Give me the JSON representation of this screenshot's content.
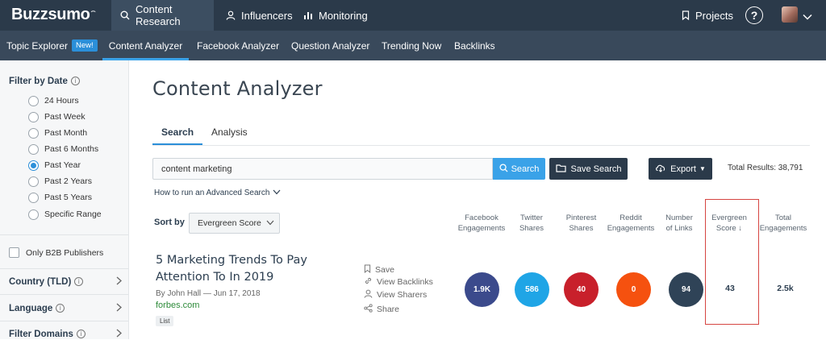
{
  "brand": {
    "logo": "Buzzsumo"
  },
  "topnav": {
    "items": [
      {
        "label": "Content Research",
        "icon": "search-icon",
        "active": true
      },
      {
        "label": "Influencers",
        "icon": "user-icon",
        "active": false
      },
      {
        "label": "Monitoring",
        "icon": "bar-chart-icon",
        "active": false
      }
    ],
    "projects_label": "Projects",
    "help_label": "?"
  },
  "subnav": {
    "items": [
      {
        "label": "Topic Explorer",
        "badge": "New!"
      },
      {
        "label": "Content Analyzer",
        "active": true
      },
      {
        "label": "Facebook Analyzer"
      },
      {
        "label": "Question Analyzer"
      },
      {
        "label": "Trending Now"
      },
      {
        "label": "Backlinks"
      }
    ]
  },
  "sidebar": {
    "filter_title": "Filter by Date",
    "date_options": [
      "24 Hours",
      "Past Week",
      "Past Month",
      "Past 6 Months",
      "Past Year",
      "Past 2 Years",
      "Past 5 Years",
      "Specific Range"
    ],
    "selected_date": "Past Year",
    "b2b_label": "Only B2B Publishers",
    "sections": [
      "Country (TLD)",
      "Language",
      "Filter Domains"
    ]
  },
  "main": {
    "title": "Content Analyzer",
    "tabs": [
      {
        "label": "Search",
        "active": true
      },
      {
        "label": "Analysis",
        "active": false
      }
    ],
    "search": {
      "value": "content marketing",
      "button": "Search"
    },
    "save_search": "Save Search",
    "export": "Export",
    "total_results": "Total Results: 38,791",
    "advanced_link": "How to run an Advanced Search",
    "sort": {
      "label": "Sort by",
      "value": "Evergreen Score"
    },
    "columns": [
      {
        "line1": "Facebook",
        "line2": "Engagements"
      },
      {
        "line1": "Twitter",
        "line2": "Shares"
      },
      {
        "line1": "Pinterest",
        "line2": "Shares"
      },
      {
        "line1": "Reddit",
        "line2": "Engagements"
      },
      {
        "line1": "Number",
        "line2": "of Links"
      },
      {
        "line1": "Evergreen",
        "line2": "Score ↓"
      },
      {
        "line1": "Total",
        "line2": "Engagements"
      }
    ]
  },
  "result": {
    "title": "5 Marketing Trends To Pay Attention To In 2019",
    "byline": "By John Hall — Jun 17, 2018",
    "domain": "forbes.com",
    "tag": "List",
    "actions": [
      "Save",
      "View Backlinks",
      "View Sharers",
      "Share"
    ],
    "metrics": {
      "facebook": "1.9K",
      "twitter": "586",
      "pinterest": "40",
      "reddit": "0",
      "links": "94",
      "evergreen": "43",
      "total": "2.5k"
    }
  },
  "colors": {
    "nav_dark": "#2b3a4a",
    "subnav": "#39495b",
    "accent_blue": "#3aa2e8",
    "facebook": "#3b4a8c",
    "twitter": "#1fa5e6",
    "pinterest": "#c8202b",
    "reddit": "#f5510f",
    "links": "#2f4357",
    "highlight": "#d64541"
  }
}
